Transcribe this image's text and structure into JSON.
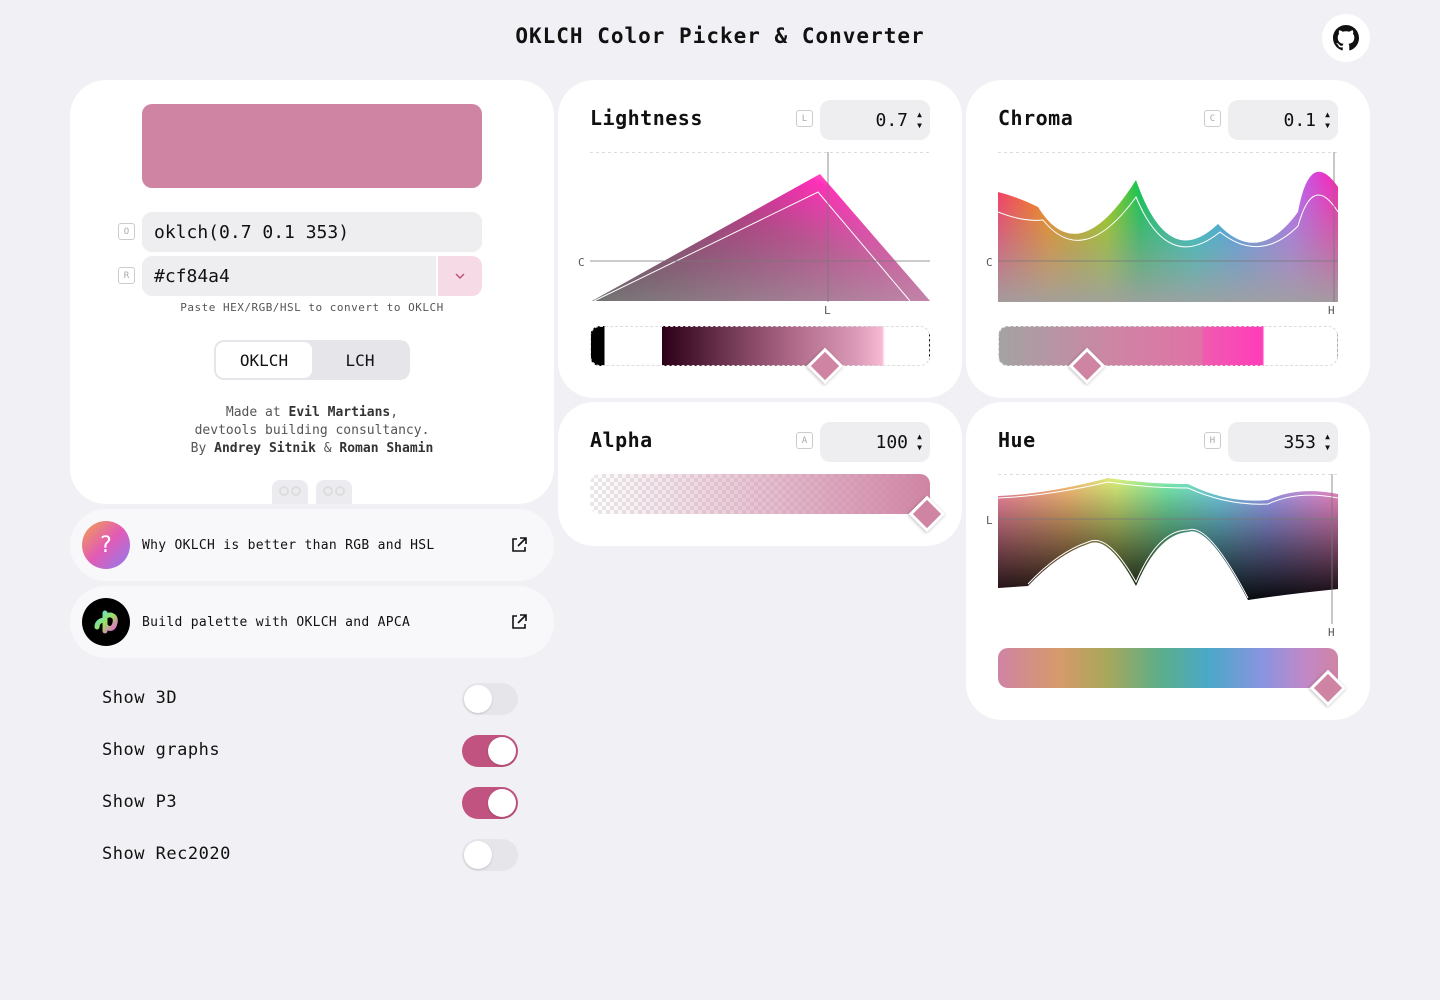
{
  "header": {
    "title": "OKLCH Color Picker & Converter",
    "github_icon": "github-icon"
  },
  "color": {
    "hex_value": "#cf84a4"
  },
  "inputs": {
    "oklch_key": "O",
    "oklch_value": "oklch(0.7 0.1 353)",
    "rgb_key": "R",
    "hex_value": "#cf84a4",
    "hint": "Paste HEX/RGB/HSL to convert to OKLCH"
  },
  "mode": {
    "options": [
      "OKLCH",
      "LCH"
    ],
    "selected": "OKLCH"
  },
  "credits": {
    "made_at": "Made at",
    "company": "Evil Martians",
    "line2": "devtools building consultancy.",
    "by": "By",
    "author1": "Andrey Sitnik",
    "amp": "&",
    "author2": "Roman Shamin"
  },
  "links": [
    {
      "label": "Why OKLCH is better than RGB and HSL",
      "icon": "question-icon"
    },
    {
      "label": "Build palette with OKLCH and APCA",
      "icon": "huetone-logo-icon"
    }
  ],
  "toggles": [
    {
      "label": "Show 3D",
      "on": false
    },
    {
      "label": "Show graphs",
      "on": true
    },
    {
      "label": "Show P3",
      "on": true
    },
    {
      "label": "Show Rec2020",
      "on": false
    }
  ],
  "controls": {
    "lightness": {
      "title": "Lightness",
      "key": "L",
      "value": "0.7",
      "axis_y": "C",
      "axis_x": "L",
      "fraction": 0.7
    },
    "chroma": {
      "title": "Chroma",
      "key": "C",
      "value": "0.1",
      "axis_y": "C",
      "axis_x": "H",
      "fraction": 0.27
    },
    "alpha": {
      "title": "Alpha",
      "key": "A",
      "value": "100",
      "fraction": 1.0
    },
    "hue": {
      "title": "Hue",
      "key": "H",
      "value": "353",
      "axis_y": "L",
      "axis_x": "H",
      "fraction": 0.98
    }
  },
  "colors": {
    "accent": "#c0537f",
    "swatch": "#cf84a4",
    "background": "#f1f1f5"
  }
}
